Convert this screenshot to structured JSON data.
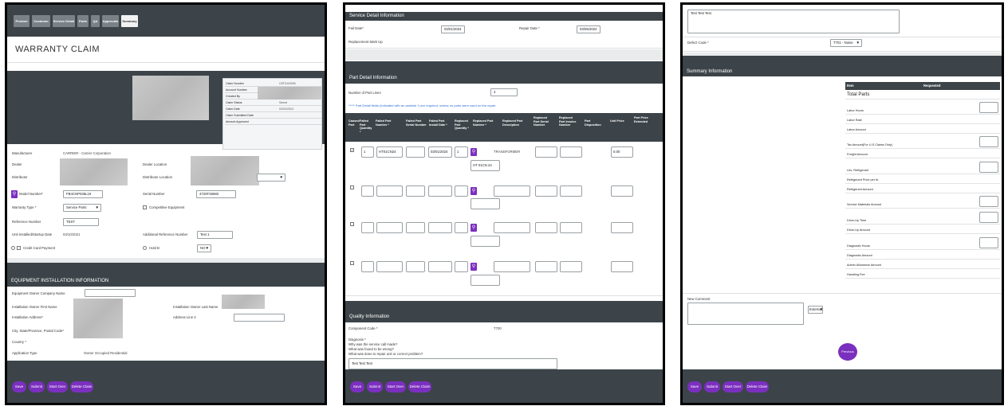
{
  "tabs": [
    "Product",
    "Customer",
    "Service Detail",
    "Parts",
    "QA",
    "Approvals",
    "Summary"
  ],
  "page_title": "WARRANTY CLAIM",
  "claim_info": [
    {
      "label": "Claim Number",
      "value": "C8TG4/0395"
    },
    {
      "label": "Account Number",
      "value": ""
    },
    {
      "label": "Created By",
      "value": ""
    },
    {
      "label": "Claim Status",
      "value": "Saved"
    },
    {
      "label": "Claim Date",
      "value": "03/20/2024"
    },
    {
      "label": "Claim Submitted Date",
      "value": ""
    },
    {
      "label": "Amount Approved",
      "value": ""
    }
  ],
  "product": {
    "manufacturer_label": "Manufacturer",
    "manufacturer_value": "CARRIER - Carrier Corporation",
    "dealer_label": "Dealer",
    "dealer_location_label": "Dealer Location",
    "distributor_label": "Distributor",
    "distributor_location_label": "Distributor Location",
    "model_number_label": "Model Number*",
    "model_number_value": "FB4CNP036L19",
    "serial_number_label": "Serial Number",
    "serial_number_value": "4720F36682",
    "warranty_type_label": "Warranty Type *",
    "warranty_type_value": "Service Parts",
    "competitive_label": "Competitive Equipment",
    "reference_label": "Reference Number",
    "reference_value": "TEST",
    "install_date_label": "Unit Installed/Startup Date",
    "install_date_value": "03/10/2021",
    "add_ref_label": "Additional Reference Number",
    "add_ref_value": "Test 1",
    "credit_card_label": "Credit Card Payment",
    "hold_label": "Hold B",
    "hold_value": "NO"
  },
  "equipment": {
    "header": "EQUIPMENT INSTALLATION INFORMATION",
    "owner_company_label": "Equipment Owner Company Name",
    "first_name_label": "Installation Owner First Name",
    "last_name_label": "Installation Owner Last Name",
    "address_label": "Installation Address*",
    "address2_label": "Address Line 2",
    "city_label": "City, State/Province, Postal Code*",
    "country_label": "Country *",
    "app_type_label": "Application Type",
    "app_type_value": "Owner Occupied Residential"
  },
  "buttons": {
    "save": "Save",
    "submit": "Submit",
    "start_over": "Start Over",
    "delete_claim": "Delete Claim",
    "previous": "Previous"
  },
  "service": {
    "header": "Service Detail Information",
    "fail_date_label": "Fail Date*",
    "fail_date_value": "03/01/2024",
    "repair_date_label": "Repair Date *",
    "repair_date_value": "03/05/2024",
    "markup_label": "Replacement Mark Up"
  },
  "parts": {
    "header": "Part Detail Information",
    "num_lines_label": "Number of Part Lines",
    "num_lines_value": "4",
    "required_note": "***** Part Detail fields (indicated with an asterisk *) are required, unless no parts were used on the repair.",
    "columns": [
      "Caused Part",
      "Failed Part Quantity *",
      "Failed Part Number *",
      "Failed Part Serial Number",
      "Failed Part Install Date *",
      "Replaced Part Quantity *",
      "Replaced Part Number *",
      "Replaced Part Description",
      "Replaced Part Serial Number",
      "Replaced Part Invoice Number",
      "Part Disposition",
      "Unit Price",
      "Part Price Extended"
    ],
    "row1": {
      "qty": "1",
      "failed_num": "HT01CN24",
      "install_date": "03/01/2024",
      "rep_qty": "1",
      "description": "TRANSFORMER",
      "unit_price": "0.00",
      "rep_num": "HT 01CN 24"
    }
  },
  "quality": {
    "header": "Quality Information",
    "component_label": "Component Code *",
    "component_value": "T700",
    "diagnosis_label": "Diagnosis *",
    "diagnosis_q1": "Why was the service call made?",
    "diagnosis_q2": "What was found to be wrong?",
    "diagnosis_q3": "What was done to repair unit or correct problem?",
    "diagnosis_value": "Test Test Test"
  },
  "p3": {
    "top_text": "Test Test Test",
    "defect_label": "Defect Code *",
    "defect_value": "T701 - Noise",
    "summary_header": "Summary Information",
    "item_col": "Item",
    "requested_col": "Requested",
    "total_parts": "Total Parts",
    "rows": [
      "Labor Hours",
      "Labor Rate",
      "Labor Amount",
      "Tax Amount(For U.S Claims Only)",
      "Freight Amount",
      "Lbs. Refrigerant",
      "Refrigerant Price per lb.",
      "Refrigerant Amount",
      "Service Materials Amount",
      "Drive-Up Time",
      "Drive-Up Amount",
      "Diagnostic Hours",
      "Diagnostic Amount",
      "Admin Allowance Amount",
      "Handling Fee"
    ],
    "new_comment_label": "New Comment",
    "external_value": "External"
  },
  "colors": {
    "header_dark": "#3c4449",
    "button_purple": "#7b2fbf"
  }
}
